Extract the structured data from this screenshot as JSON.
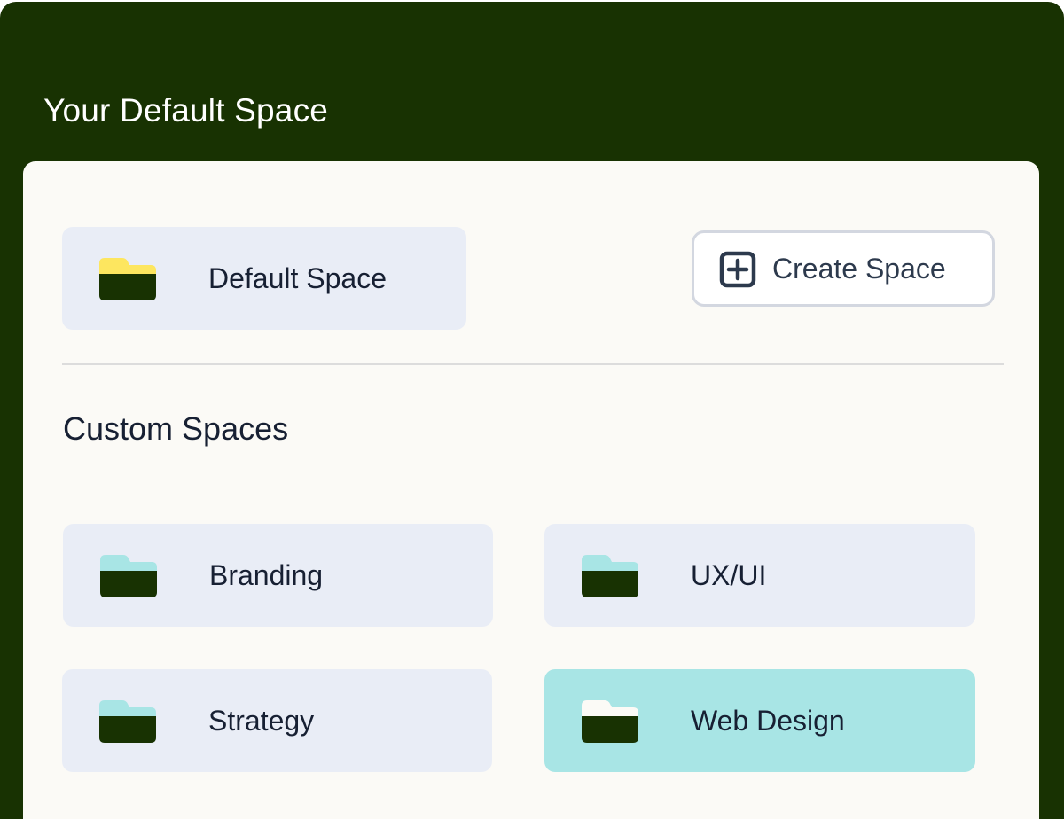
{
  "header": {
    "title": "Your Default Space"
  },
  "default_space": {
    "label": "Default Space",
    "folder_icon": "folder-yellow-icon",
    "folder_tab_color": "#fde65f",
    "folder_body_color": "#183202"
  },
  "create_button": {
    "label": "Create Space",
    "icon": "plus-square-icon"
  },
  "custom_spaces": {
    "title": "Custom Spaces",
    "items": [
      {
        "label": "Branding",
        "folder_icon": "folder-teal-icon",
        "selected": false
      },
      {
        "label": "UX/UI",
        "folder_icon": "folder-teal-icon",
        "selected": false
      },
      {
        "label": "Strategy",
        "folder_icon": "folder-teal-icon",
        "selected": false
      },
      {
        "label": "Web Design",
        "folder_icon": "folder-white-icon",
        "selected": true
      }
    ]
  },
  "colors": {
    "frame_background": "#183202",
    "panel_background": "#fbfaf6",
    "card_background": "#e9edf6",
    "selected_card_background": "#a8e5e5",
    "teal_folder_tab": "#a8e5e5",
    "text": "#172033"
  }
}
